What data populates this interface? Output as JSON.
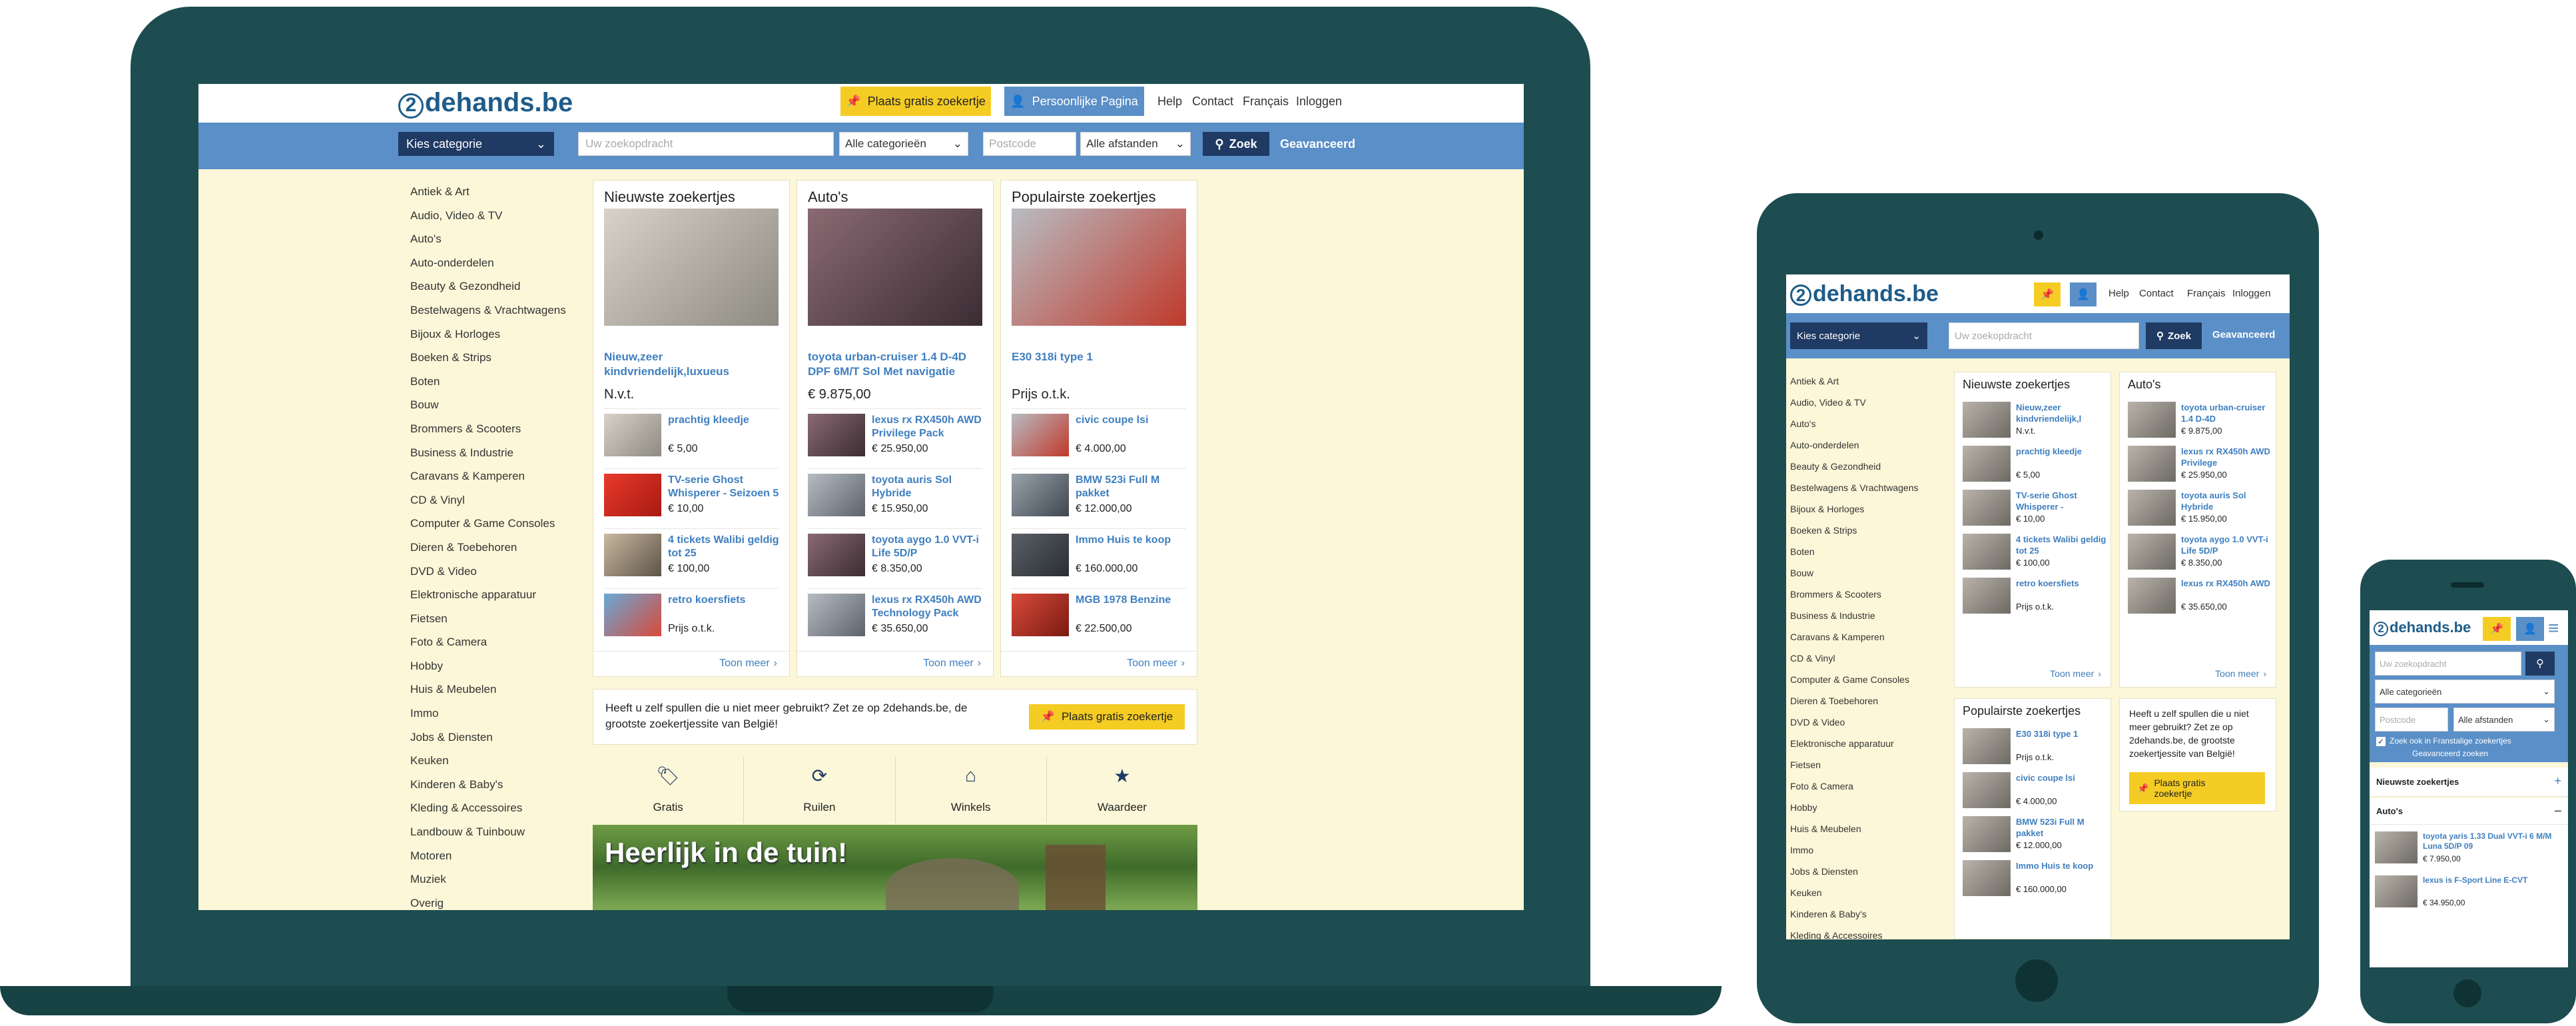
{
  "brand": {
    "logo_text": "2dehands.be",
    "logo_digit": "2",
    "logo_rest": "dehands.be"
  },
  "colors": {
    "frame": "#1d4d50",
    "accent_blue": "#5a8fc7",
    "dark_blue": "#1f3a63",
    "yellow": "#f5cc24",
    "page_bg": "#fdf7d9",
    "link": "#3f7fbf"
  },
  "header": {
    "post_ad": "Plaats gratis zoekertje",
    "personal_page": "Persoonlijke Pagina",
    "help": "Help",
    "contact": "Contact",
    "francais": "Français",
    "login": "Inloggen"
  },
  "search": {
    "category_select": "Kies categorie",
    "query_placeholder": "Uw zoekopdracht",
    "all_categories": "Alle categorieën",
    "postcode_placeholder": "Postcode",
    "all_distances": "Alle afstanden",
    "search_button": "Zoek",
    "advanced": "Geavanceerd",
    "advanced_long": "Geavanceerd zoeken",
    "search_french": "Zoek ook in Franstalige zoekertjes"
  },
  "categories": [
    "Antiek & Art",
    "Audio, Video & TV",
    "Auto's",
    "Auto-onderdelen",
    "Beauty & Gezondheid",
    "Bestelwagens & Vrachtwagens",
    "Bijoux & Horloges",
    "Boeken & Strips",
    "Boten",
    "Bouw",
    "Brommers & Scooters",
    "Business & Industrie",
    "Caravans & Kamperen",
    "CD & Vinyl",
    "Computer & Game Consoles",
    "Dieren & Toebehoren",
    "DVD & Video",
    "Elektronische apparatuur",
    "Fietsen",
    "Foto & Camera",
    "Hobby",
    "Huis & Meubelen",
    "Immo",
    "Jobs & Diensten",
    "Keuken",
    "Kinderen & Baby's",
    "Kleding & Accessoires",
    "Landbouw & Tuinbouw",
    "Motoren",
    "Muziek",
    "Overig"
  ],
  "cards": {
    "newest": {
      "title": "Nieuwste zoekertjes",
      "featured_title": "Nieuw,zeer kindvriendelijk,luxueus",
      "featured_price": "N.v.t.",
      "items": [
        {
          "title": "prachtig kleedje",
          "price": "€ 5,00"
        },
        {
          "title": "TV-serie Ghost Whisperer - Seizoen 5",
          "price": "€ 10,00"
        },
        {
          "title": "4 tickets Walibi geldig tot 25",
          "price": "€ 100,00"
        },
        {
          "title": "retro koersfiets",
          "price": "Prijs o.t.k."
        }
      ],
      "more": "Toon meer"
    },
    "autos": {
      "title": "Auto's",
      "featured_title": "toyota urban-cruiser 1.4 D-4D DPF 6M/T Sol Met navigatie",
      "featured_price": "€ 9.875,00",
      "items": [
        {
          "title": "lexus rx RX450h AWD Privilege Pack",
          "price": "€ 25.950,00"
        },
        {
          "title": "toyota auris Sol Hybride",
          "price": "€ 15.950,00"
        },
        {
          "title": "toyota aygo 1.0 VVT-i Life 5D/P",
          "price": "€ 8.350,00"
        },
        {
          "title": "lexus rx RX450h AWD Technology Pack",
          "price": "€ 35.650,00"
        }
      ],
      "more": "Toon meer"
    },
    "popular": {
      "title": "Populairste zoekertjes",
      "featured_title": "E30 318i type 1",
      "featured_price": "Prijs o.t.k.",
      "items": [
        {
          "title": "civic coupe lsi",
          "price": "€ 4.000,00"
        },
        {
          "title": "BMW 523i Full M pakket",
          "price": "€ 12.000,00"
        },
        {
          "title": "Immo Huis te koop",
          "price": "€ 160.000,00"
        },
        {
          "title": "MGB 1978 Benzine",
          "price": "€ 22.500,00"
        }
      ],
      "more": "Toon meer"
    }
  },
  "promo": {
    "text": "Heeft u zelf spullen die u niet meer gebruikt? Zet ze op 2dehands.be, de grootste zoekertjessite van België!",
    "button": "Plaats gratis zoekertje"
  },
  "features": [
    {
      "icon": "tag-icon",
      "label": "Gratis"
    },
    {
      "icon": "swap-icon",
      "label": "Ruilen"
    },
    {
      "icon": "store-icon",
      "label": "Winkels"
    },
    {
      "icon": "star-icon",
      "label": "Waardeer"
    }
  ],
  "banner": {
    "title": "Heerlijk in de tuin!"
  },
  "tablet": {
    "newest_items": [
      {
        "title": "Nieuw,zeer kindvriendelijk,l",
        "price": "N.v.t."
      },
      {
        "title": "prachtig kleedje",
        "price": "€ 5,00"
      },
      {
        "title": "TV-serie Ghost Whisperer -",
        "price": "€ 10,00"
      },
      {
        "title": "4 tickets Walibi geldig tot 25",
        "price": "€ 100,00"
      },
      {
        "title": "retro koersfiets",
        "price": "Prijs o.t.k."
      }
    ],
    "auto_items": [
      {
        "title": "toyota urban-cruiser 1.4 D-4D",
        "price": "€ 9.875,00"
      },
      {
        "title": "lexus rx RX450h AWD Privilege",
        "price": "€ 25.950,00"
      },
      {
        "title": "toyota auris Sol Hybride",
        "price": "€ 15.950,00"
      },
      {
        "title": "toyota aygo 1.0 VVT-i Life 5D/P",
        "price": "€ 8.350,00"
      },
      {
        "title": "lexus rx RX450h AWD",
        "price": "€ 35.650,00"
      }
    ],
    "popular_items": [
      {
        "title": "E30 318i type 1",
        "price": "Prijs o.t.k."
      },
      {
        "title": "civic coupe lsi",
        "price": "€ 4.000,00"
      },
      {
        "title": "BMW 523i Full M pakket",
        "price": "€ 12.000,00"
      },
      {
        "title": "Immo Huis te koop",
        "price": "€ 160.000,00"
      }
    ],
    "promo_text": "Heeft u zelf spullen die u niet meer gebruikt? Zet ze op 2dehands.be, de grootste zoekertjessite van België!",
    "promo_button": "Plaats gratis zoekertje"
  },
  "phone": {
    "section_newest": "Nieuwste zoekertjes",
    "section_autos": "Auto's",
    "expand": "+",
    "collapse": "–",
    "items": [
      {
        "title": "toyota yaris 1.33 Dual VVT-i 6 M/M Luna 5D/P 09",
        "price": "€ 7.950,00"
      },
      {
        "title": "lexus is F-Sport Line E-CVT",
        "price": "€ 34.950,00"
      }
    ]
  }
}
